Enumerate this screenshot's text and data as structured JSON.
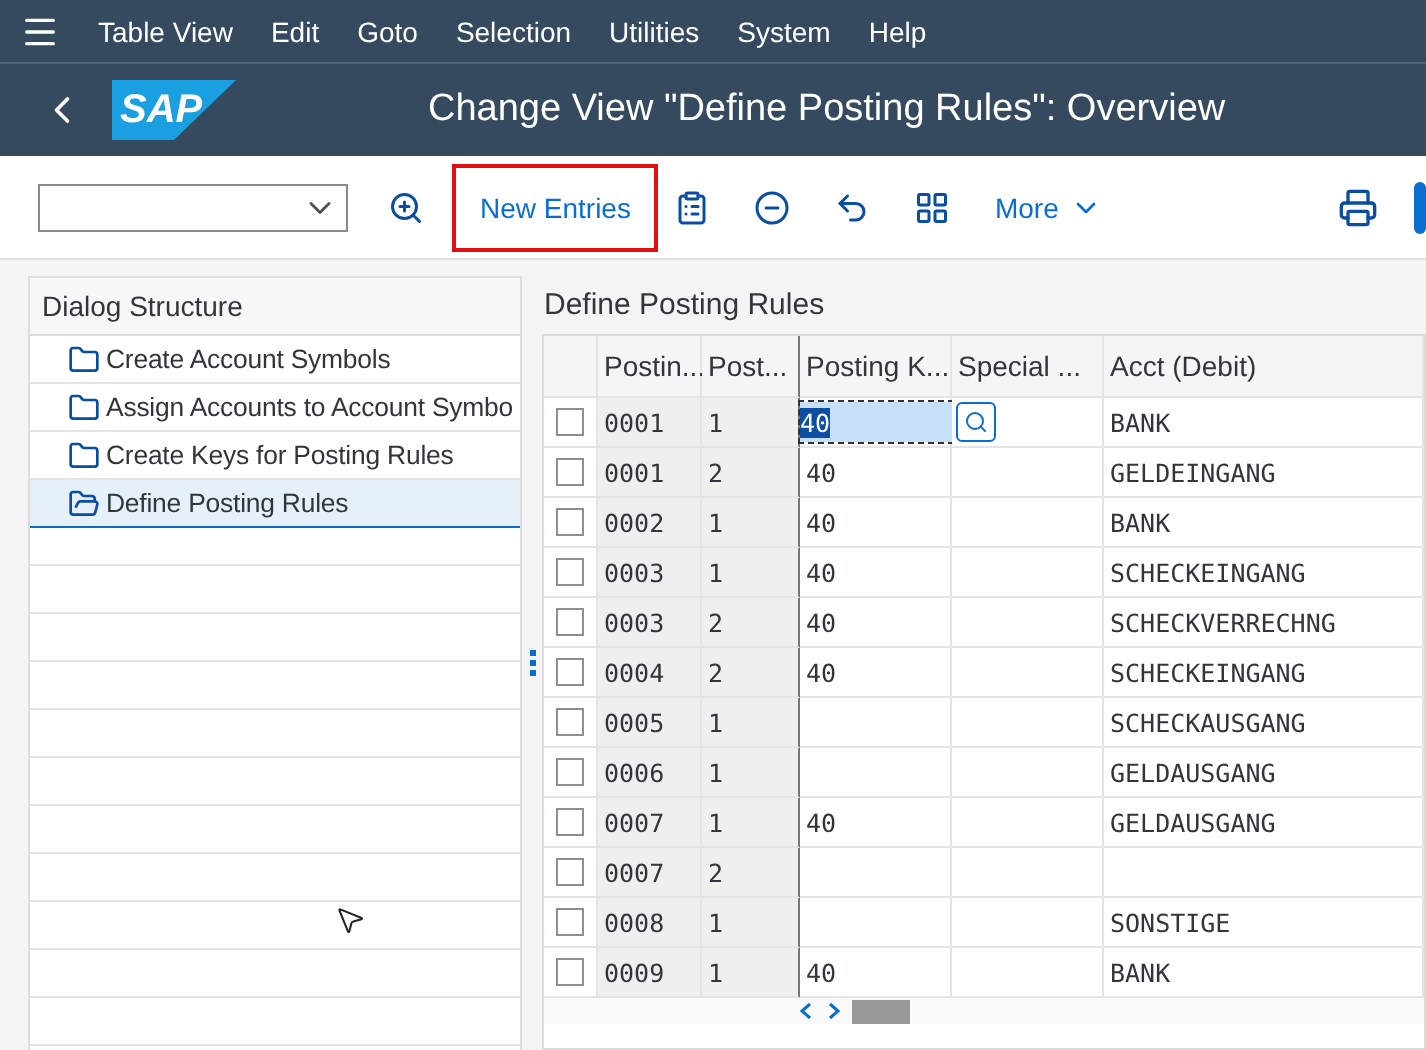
{
  "menu_bar": {
    "items": [
      "Table View",
      "Edit",
      "Goto",
      "Selection",
      "Utilities",
      "System",
      "Help"
    ]
  },
  "title_bar": {
    "logo": "SAP",
    "title": "Change View \"Define Posting Rules\": Overview"
  },
  "toolbar": {
    "buttons": [
      {
        "label": "New Entries",
        "highlighted": true
      },
      {
        "label": "More",
        "highlighted": false
      }
    ]
  },
  "dialog_structure": {
    "title": "Dialog Structure",
    "items": [
      {
        "label": "Create Account Symbols",
        "selected": false
      },
      {
        "label": "Assign Accounts to Account Symbo",
        "selected": false
      },
      {
        "label": "Create Keys for Posting Rules",
        "selected": false
      },
      {
        "label": "Define Posting Rules",
        "selected": true
      }
    ]
  },
  "table": {
    "title": "Define Posting Rules",
    "columns": [
      "Postin...",
      "Post...",
      "Posting K...",
      "Special ...",
      "Acct (Debit)"
    ],
    "rows": [
      {
        "cells": [
          "0001",
          "1",
          "40",
          "",
          "BANK"
        ],
        "checked": false,
        "focused": true
      },
      {
        "cells": [
          "0001",
          "2",
          "40",
          "",
          "GELDEINGANG"
        ],
        "checked": false,
        "focused": false
      },
      {
        "cells": [
          "0002",
          "1",
          "40",
          "",
          "BANK"
        ],
        "checked": false,
        "focused": false
      },
      {
        "cells": [
          "0003",
          "1",
          "40",
          "",
          "SCHECKEINGANG"
        ],
        "checked": false,
        "focused": false
      },
      {
        "cells": [
          "0003",
          "2",
          "40",
          "",
          "SCHECKVERRECHNG"
        ],
        "checked": false,
        "focused": false
      },
      {
        "cells": [
          "0004",
          "2",
          "40",
          "",
          "SCHECKEINGANG"
        ],
        "checked": false,
        "focused": false
      },
      {
        "cells": [
          "0005",
          "1",
          "",
          "",
          "SCHECKAUSGANG"
        ],
        "checked": false,
        "focused": false
      },
      {
        "cells": [
          "0006",
          "1",
          "",
          "",
          "GELDAUSGANG"
        ],
        "checked": false,
        "focused": false
      },
      {
        "cells": [
          "0007",
          "1",
          "40",
          "",
          "GELDAUSGANG"
        ],
        "checked": false,
        "focused": false
      },
      {
        "cells": [
          "0007",
          "2",
          "",
          "",
          ""
        ],
        "checked": false,
        "focused": false
      },
      {
        "cells": [
          "0008",
          "1",
          "",
          "",
          "SONSTIGE"
        ],
        "checked": false,
        "focused": false
      },
      {
        "cells": [
          "0009",
          "1",
          "40",
          "",
          "BANK"
        ],
        "checked": false,
        "focused": false
      }
    ]
  }
}
